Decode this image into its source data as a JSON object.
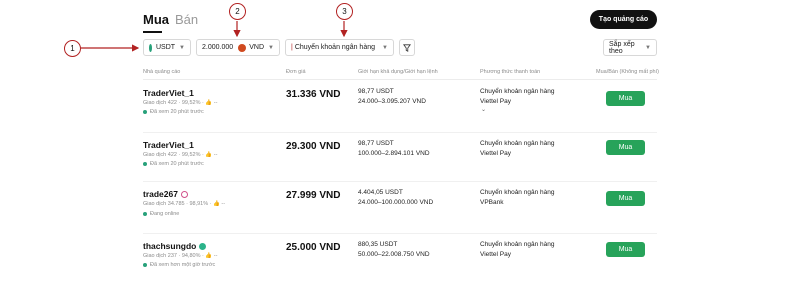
{
  "tabs": {
    "buy": "Mua",
    "sell": "Bán"
  },
  "create_ad_label": "Tạo quảng cáo",
  "filters": {
    "coin": "USDT",
    "amount": "2.000.000",
    "fiat": "VND",
    "payment": "Chuyển khoản ngân hàng",
    "sort": "Sắp xếp theo"
  },
  "columns": {
    "advertiser": "Nhà quảng cáo",
    "price": "Đơn giá",
    "limits": "Giới hạn khả dụng/Giới hạn lệnh",
    "payment": "Phương thức thanh toán",
    "trade": "Mua/Bán (Không mất phí)"
  },
  "callouts": [
    "1",
    "2",
    "3"
  ],
  "colors": {
    "accent_green": "#27a35a",
    "callout_red": "#b22222",
    "dark": "#111111"
  },
  "listings": [
    {
      "name": "TraderViet_1",
      "stats": "Giao dịch 422 · 99,52% · 👍 --",
      "status": "Đã xem 20 phút trước",
      "price": "31.336 VND",
      "available": "98,77 USDT",
      "limit": "24.000–3.095.207 VND",
      "pay1": "Chuyển khoản ngân hàng",
      "pay2": "Viettel Pay",
      "pay_more": "⌄",
      "button": "Mua"
    },
    {
      "name": "TraderViet_1",
      "stats": "Giao dịch 422 · 99,52% · 👍 --",
      "status": "Đã xem 20 phút trước",
      "price": "29.300 VND",
      "available": "98,77 USDT",
      "limit": "100.000–2.894.101 VND",
      "pay1": "Chuyển khoản ngân hàng",
      "pay2": "Viettel Pay",
      "pay_more": "",
      "button": "Mua"
    },
    {
      "name": "trade267",
      "stats": "Giao dịch 34.785 · 98,91% · 👍 --",
      "status": "Đang online",
      "price": "27.999 VND",
      "available": "4.404,05 USDT",
      "limit": "24.000–100.000.000 VND",
      "pay1": "Chuyển khoản ngân hàng",
      "pay2": "VPBank",
      "pay_more": "",
      "button": "Mua"
    },
    {
      "name": "thachsungdo",
      "stats": "Giao dịch 237 · 94,80% · 👍 --",
      "status": "Đã xem hơn một giờ trước",
      "price": "25.000 VND",
      "available": "880,35 USDT",
      "limit": "50.000–22.008.750 VND",
      "pay1": "Chuyển khoản ngân hàng",
      "pay2": "Viettel Pay",
      "pay_more": "",
      "button": "Mua"
    }
  ]
}
